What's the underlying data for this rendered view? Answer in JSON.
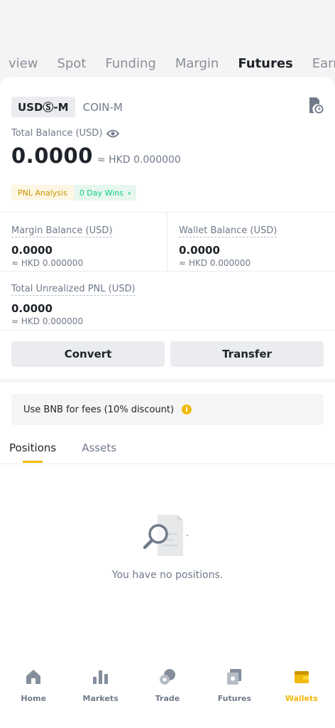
{
  "top_tabs": [
    {
      "label": "view"
    },
    {
      "label": "Spot"
    },
    {
      "label": "Funding"
    },
    {
      "label": "Margin"
    },
    {
      "label": "Futures"
    },
    {
      "label": "Earn"
    }
  ],
  "segment": {
    "usds_m": "USDⓈ-M",
    "coin_m": "COIN-M"
  },
  "total_balance": {
    "label": "Total Balance (USD)",
    "value": "0.0000",
    "fiat": "≈ HKD 0.000000"
  },
  "pnl": {
    "analysis_label": "PNL Analysis",
    "wins_label": "0 Day Wins",
    "chevron": "›"
  },
  "stats": {
    "margin_balance": {
      "label": "Margin Balance (USD)",
      "value": "0.0000",
      "fiat": "≈ HKD 0.000000"
    },
    "wallet_balance": {
      "label": "Wallet Balance (USD)",
      "value": "0.0000",
      "fiat": "≈ HKD 0.000000"
    },
    "unrealized_pnl": {
      "label": "Total Unrealized PNL (USD)",
      "value": "0.0000",
      "fiat": "≈ HKD 0.000000"
    }
  },
  "buttons": {
    "convert": "Convert",
    "transfer": "Transfer"
  },
  "bnb_notice": {
    "text": "Use BNB for fees (10% discount)",
    "info_glyph": "i"
  },
  "sub_tabs": {
    "positions": "Positions",
    "assets": "Assets"
  },
  "empty_state": {
    "text": "You have no positions."
  },
  "bottom_nav": {
    "home": "Home",
    "markets": "Markets",
    "trade": "Trade",
    "futures": "Futures",
    "wallets": "Wallets"
  },
  "colors": {
    "accent": "#f0b90b",
    "text_primary": "#1e2329",
    "text_secondary": "#707a8a",
    "positive": "#0ecb81"
  },
  "icons": {
    "history": "order-history-icon",
    "eye": "eye-icon",
    "info": "info-icon",
    "empty": "search-document-icon",
    "home": "home-icon",
    "markets": "bar-chart-icon",
    "trade": "trade-coins-icon",
    "futures": "futures-icon",
    "wallets": "wallet-icon"
  }
}
